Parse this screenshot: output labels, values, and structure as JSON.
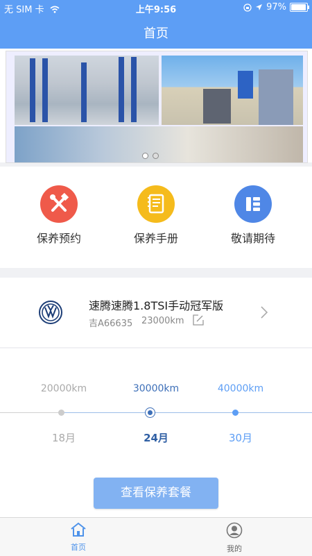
{
  "status_bar": {
    "carrier": "无 SIM 卡",
    "time": "上午9:56",
    "battery": "97%",
    "battery_level": 0.97
  },
  "header": {
    "title": "首页"
  },
  "banner": {
    "slide_count": 2,
    "active_slide": 0
  },
  "features": [
    {
      "label": "保养预约",
      "icon": "wrench-hammer-icon",
      "color": "#ef5a4a"
    },
    {
      "label": "保养手册",
      "icon": "notebook-icon",
      "color": "#f5bb1c"
    },
    {
      "label": "敬请期待",
      "icon": "grid-list-icon",
      "color": "#4f87e6"
    }
  ],
  "car": {
    "brand_icon": "volkswagen-logo-icon",
    "name": "速腾速腾1.8TSI手动冠军版",
    "plate": "吉A66635",
    "mileage": "23000km"
  },
  "timeline": {
    "milestones": [
      {
        "km": "20000km",
        "month": "18月",
        "state": "past"
      },
      {
        "km": "30000km",
        "month": "24月",
        "state": "current"
      },
      {
        "km": "40000km",
        "month": "30月",
        "state": "future"
      }
    ]
  },
  "actions": {
    "view_package": "查看保养套餐"
  },
  "tabbar": {
    "items": [
      {
        "label": "首页",
        "icon": "home-icon",
        "active": true
      },
      {
        "label": "我的",
        "icon": "user-icon",
        "active": false
      }
    ]
  },
  "colors": {
    "primary": "#5d9ef5",
    "button": "#82b2f2",
    "active_tab": "#4f93ea",
    "muted": "#aaaaaa"
  }
}
